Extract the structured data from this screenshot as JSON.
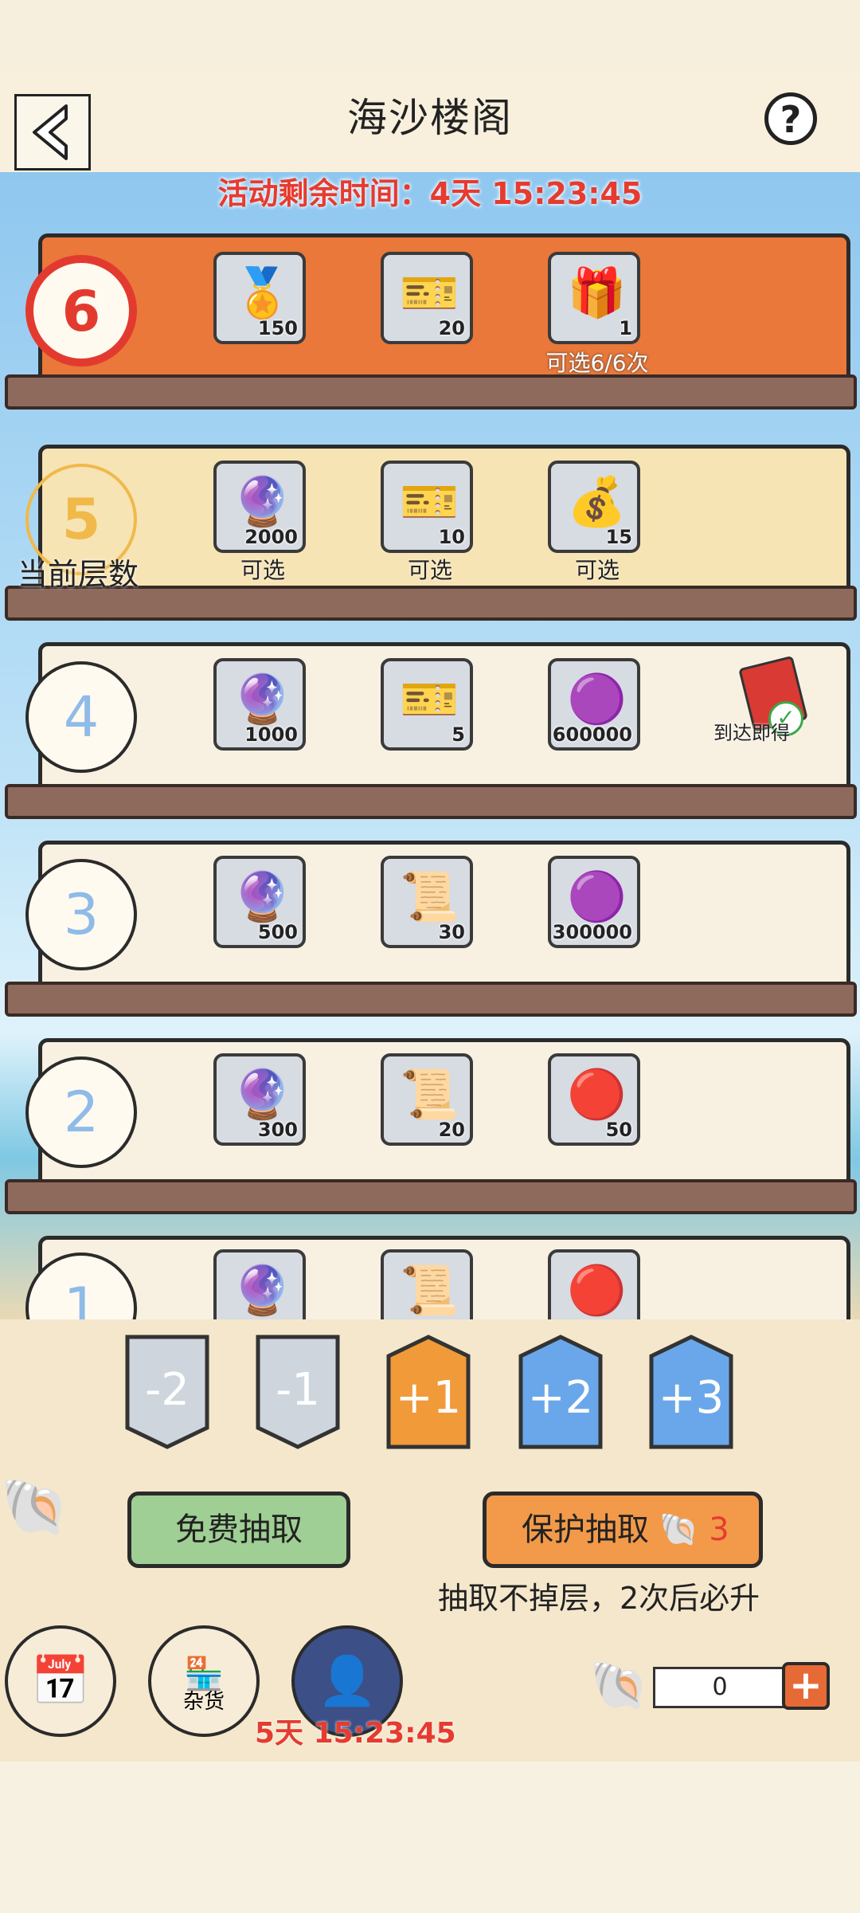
{
  "header": {
    "title": "海沙楼阁",
    "help_label": "?"
  },
  "event_timer": "活动剩余时间：4天 15:23:45",
  "floors": [
    {
      "number": "6",
      "items": [
        {
          "icon": "gold-token-icon",
          "glyph": "🏅",
          "qty": "150",
          "sub": ""
        },
        {
          "icon": "ticket-icon",
          "glyph": "🎫",
          "qty": "20",
          "sub": ""
        },
        {
          "icon": "gift-box-icon",
          "glyph": "🎁",
          "qty": "1",
          "sub": "可选6/6次"
        }
      ]
    },
    {
      "number": "5",
      "current_label": "当前层数",
      "items": [
        {
          "icon": "orb-icon",
          "glyph": "🔮",
          "qty": "2000",
          "sub": "可选"
        },
        {
          "icon": "ticket-icon",
          "glyph": "🎫",
          "qty": "10",
          "sub": "可选"
        },
        {
          "icon": "money-bag-icon",
          "glyph": "💰",
          "qty": "15",
          "sub": "可选"
        }
      ]
    },
    {
      "number": "4",
      "items": [
        {
          "icon": "orb-icon",
          "glyph": "🔮",
          "qty": "1000",
          "sub": ""
        },
        {
          "icon": "ticket-icon",
          "glyph": "🎫",
          "qty": "5",
          "sub": ""
        },
        {
          "icon": "coin-icon",
          "glyph": "🟣",
          "qty": "600000",
          "sub": ""
        }
      ],
      "reward_label": "到达即得"
    },
    {
      "number": "3",
      "items": [
        {
          "icon": "orb-icon",
          "glyph": "🔮",
          "qty": "500",
          "sub": ""
        },
        {
          "icon": "scroll-icon",
          "glyph": "📜",
          "qty": "30",
          "sub": ""
        },
        {
          "icon": "coin-icon",
          "glyph": "🟣",
          "qty": "300000",
          "sub": ""
        }
      ]
    },
    {
      "number": "2",
      "items": [
        {
          "icon": "orb-icon",
          "glyph": "🔮",
          "qty": "300",
          "sub": ""
        },
        {
          "icon": "scroll-icon",
          "glyph": "📜",
          "qty": "20",
          "sub": ""
        },
        {
          "icon": "pearl-icon",
          "glyph": "🔴",
          "qty": "50",
          "sub": ""
        }
      ]
    },
    {
      "number": "1",
      "items": [
        {
          "icon": "orb-icon",
          "glyph": "🔮",
          "qty": "",
          "sub": ""
        },
        {
          "icon": "scroll-icon",
          "glyph": "📜",
          "qty": "",
          "sub": ""
        },
        {
          "icon": "pearl-icon",
          "glyph": "🔴",
          "qty": "",
          "sub": ""
        }
      ]
    }
  ],
  "level_tags": [
    "-2",
    "-1",
    "+1",
    "+2",
    "+3"
  ],
  "actions": {
    "free_draw": "免费抽取",
    "protect_draw": "保护抽取",
    "protect_count": "3",
    "note": "抽取不掉层，2次后必升"
  },
  "bottom": {
    "shop_label": "杂货",
    "timer": "5天 15:23:45",
    "shell_count": "0"
  },
  "colors": {
    "accent_red": "#e63b30",
    "floor6_bg": "#e9783a",
    "floor5_bg": "#f7e4b5",
    "floor_bg": "#f8f1e2",
    "tag_gray": "#cfd5dc",
    "tag_orange": "#f09a3a",
    "tag_blue": "#6aa7ea"
  }
}
